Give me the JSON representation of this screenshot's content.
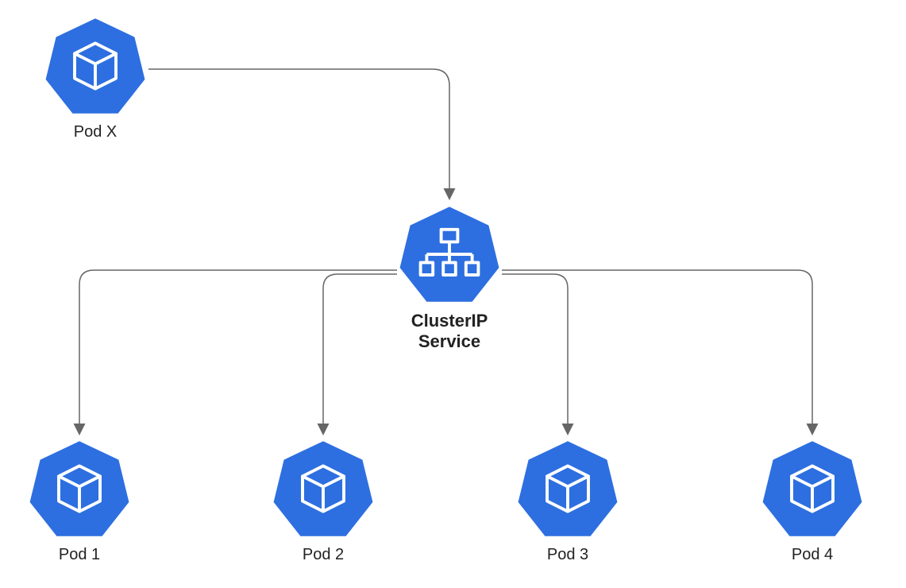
{
  "nodes": {
    "podx": {
      "label": "Pod X",
      "icon": "cube"
    },
    "service": {
      "label": "ClusterIP\nService",
      "icon": "tree"
    },
    "pod1": {
      "label": "Pod 1",
      "icon": "cube"
    },
    "pod2": {
      "label": "Pod 2",
      "icon": "cube"
    },
    "pod3": {
      "label": "Pod 3",
      "icon": "cube"
    },
    "pod4": {
      "label": "Pod 4",
      "icon": "cube"
    }
  },
  "colors": {
    "fill": "#2d6fe0",
    "stroke": "#ffffff",
    "arrow": "#666666"
  },
  "edges": [
    {
      "from": "podx",
      "to": "service"
    },
    {
      "from": "service",
      "to": "pod1"
    },
    {
      "from": "service",
      "to": "pod2"
    },
    {
      "from": "service",
      "to": "pod3"
    },
    {
      "from": "service",
      "to": "pod4"
    }
  ]
}
